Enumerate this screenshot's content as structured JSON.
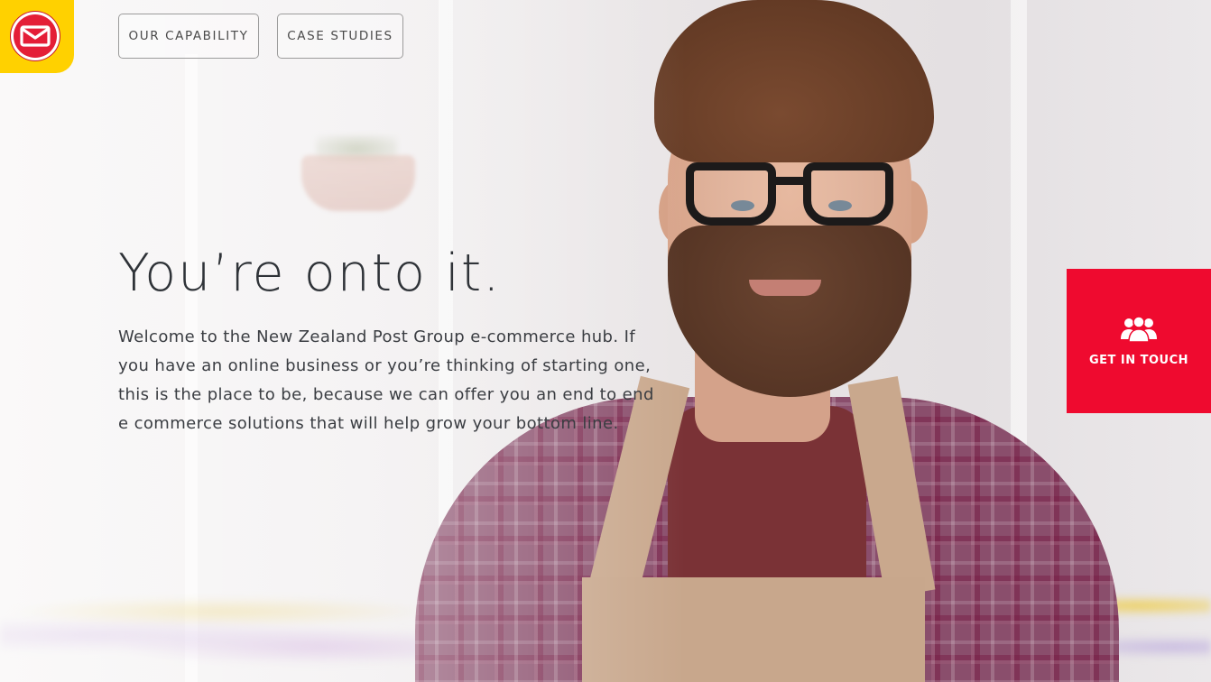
{
  "brand": {
    "logo_icon": "envelope-icon",
    "logo_colors": {
      "background": "#ffd100",
      "circle": "#e41e37"
    }
  },
  "nav": {
    "items": [
      {
        "label": "OUR CAPABILITY"
      },
      {
        "label": "CASE STUDIES"
      }
    ]
  },
  "hero": {
    "title": "You’re onto it.",
    "body": "Welcome to the New Zealand Post Group e-commerce hub. If you have an online business or you’re thinking of starting one, this is the place to be, because we can offer you an end to end e commerce solutions that will help grow your bottom line."
  },
  "contact_tab": {
    "icon": "people-group-icon",
    "label": "GET IN TOUCH",
    "color": "#ef0a2f"
  }
}
